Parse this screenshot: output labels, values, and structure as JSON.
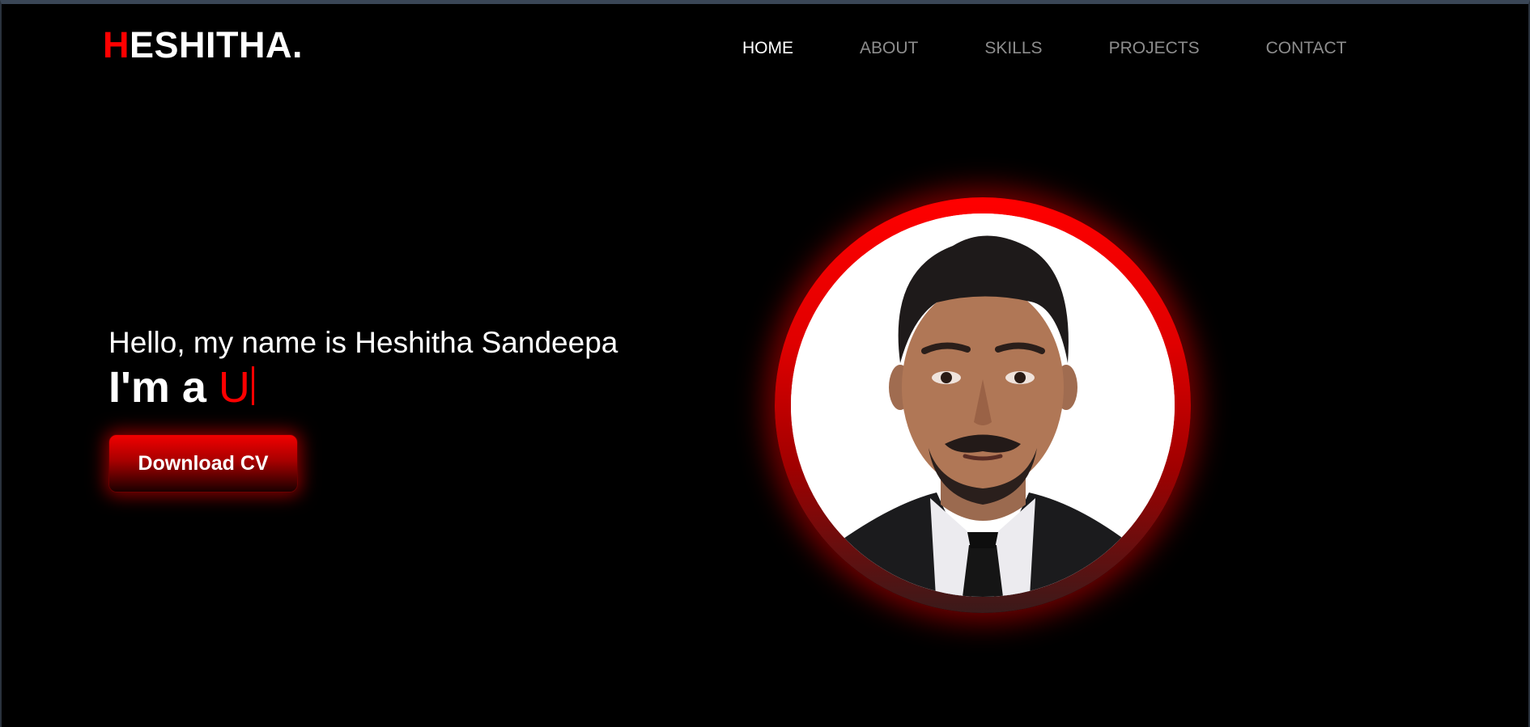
{
  "header": {
    "logo_first_letter": "H",
    "logo_rest": "ESHITHA.",
    "nav": [
      {
        "label": "HOME",
        "active": true
      },
      {
        "label": "ABOUT",
        "active": false
      },
      {
        "label": "SKILLS",
        "active": false
      },
      {
        "label": "PROJECTS",
        "active": false
      },
      {
        "label": "CONTACT",
        "active": false
      }
    ]
  },
  "hero": {
    "greeting": "Hello, my name is Heshitha Sandeepa",
    "role_prefix": "I'm a ",
    "role_typed": "U",
    "cv_button": "Download CV",
    "portrait": "profile-photo"
  },
  "colors": {
    "accent": "#ff0000",
    "background": "#000000",
    "nav_inactive": "#8d8d8d",
    "nav_active": "#ffffff"
  }
}
